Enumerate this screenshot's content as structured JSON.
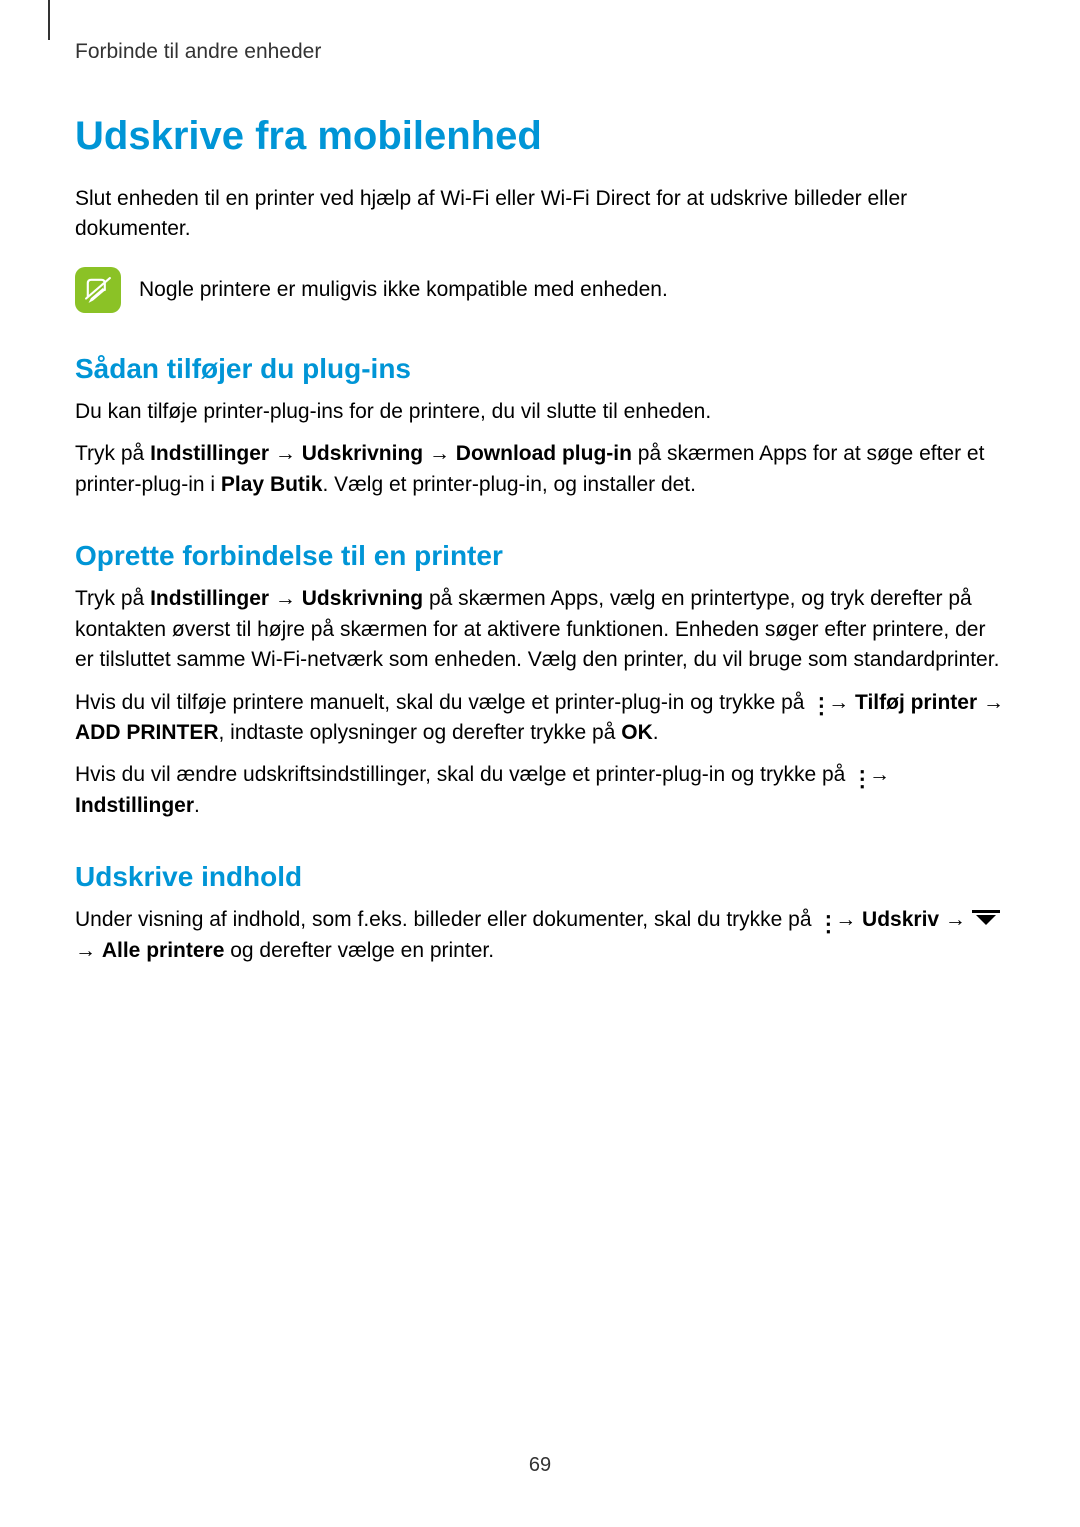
{
  "header": "Forbinde til andre enheder",
  "title": "Udskrive fra mobilenhed",
  "intro": "Slut enheden til en printer ved hjælp af Wi-Fi eller Wi-Fi Direct for at udskrive billeder eller dokumenter.",
  "note": "Nogle printere er muligvis ikke kompatible med enheden.",
  "section1": {
    "heading": "Sådan tilføjer du plug-ins",
    "p1": "Du kan tilføje printer-plug-ins for de printere, du vil slutte til enheden.",
    "p2_pre": "Tryk på ",
    "p2_b1": "Indstillinger",
    "arrow": " → ",
    "p2_b2": "Udskrivning",
    "p2_b3": "Download plug-in",
    "p2_mid": " på skærmen Apps for at søge efter et printer-plug-in i ",
    "p2_b4": "Play Butik",
    "p2_end": ". Vælg et printer-plug-in, og installer det."
  },
  "section2": {
    "heading": "Oprette forbindelse til en printer",
    "p1_pre": "Tryk på ",
    "p1_b1": "Indstillinger",
    "p1_b2": "Udskrivning",
    "p1_end": " på skærmen Apps, vælg en printertype, og tryk derefter på kontakten øverst til højre på skærmen for at aktivere funktionen. Enheden søger efter printere, der er tilsluttet samme Wi-Fi-netværk som enheden. Vælg den printer, du vil bruge som standardprinter.",
    "p2_pre": "Hvis du vil tilføje printere manuelt, skal du vælge et printer-plug-in og trykke på ",
    "p2_b1": "Tilføj printer",
    "p2_b2": "ADD PRINTER",
    "p2_mid": ", indtaste oplysninger og derefter trykke på ",
    "p2_b3": "OK",
    "p2_end": ".",
    "p3_pre": "Hvis du vil ændre udskriftsindstillinger, skal du vælge et printer-plug-in og trykke på ",
    "p3_b1": "Indstillinger",
    "p3_end": "."
  },
  "section3": {
    "heading": "Udskrive indhold",
    "p1_pre": "Under visning af indhold, som f.eks. billeder eller dokumenter, skal du trykke på ",
    "p1_b1": "Udskriv",
    "p1_b2": "Alle printere",
    "p1_end": " og derefter vælge en printer."
  },
  "pageNumber": "69"
}
